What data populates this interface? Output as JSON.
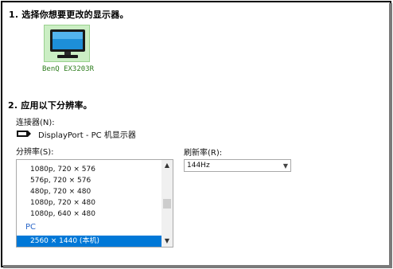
{
  "steps": {
    "step1_title": "1. 选择你想要更改的显示器。",
    "step2_title": "2. 应用以下分辨率。"
  },
  "monitor": {
    "name": "BenQ EX3203R",
    "icon": "monitor-icon",
    "tile_color": "#cbeec4"
  },
  "connector": {
    "label": "连接器(N):",
    "icon": "displayport-icon",
    "value": "DisplayPort - PC 机显示器"
  },
  "resolution": {
    "label": "分辨率(S):",
    "items": [
      "1080p, 720 × 576",
      "576p, 720 × 576",
      "480p, 720 × 480",
      "1080p, 720 × 480",
      "1080p, 640 × 480"
    ],
    "group_label": "PC",
    "selected": "2560 × 1440 (本机)"
  },
  "refresh": {
    "label": "刷新率(R):",
    "value": "144Hz"
  },
  "colors": {
    "selection": "#0078d7",
    "group_text": "#2a66c8",
    "monitor_label": "#2e7d1e"
  }
}
